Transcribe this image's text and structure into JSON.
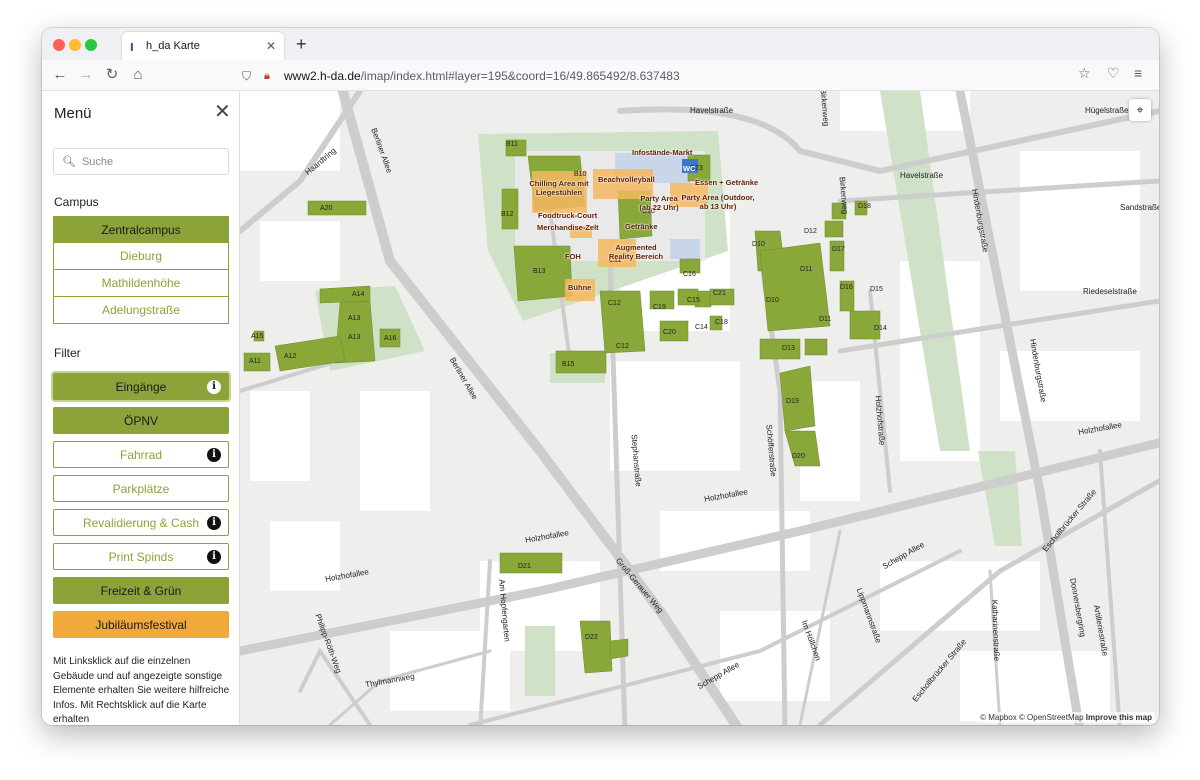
{
  "browser": {
    "tab_title": "h_da Karte",
    "new_tab": "+",
    "url_host": "www2.h-da.de",
    "url_path": "/imap/index.html#layer=195&coord=16/49.865492/8.637483"
  },
  "sidebar": {
    "title": "Menü",
    "search_placeholder": "Suche",
    "campus_label": "Campus",
    "campus": [
      {
        "label": "Zentralcampus",
        "active": true
      },
      {
        "label": "Dieburg",
        "active": false
      },
      {
        "label": "Mathildenhöhe",
        "active": false
      },
      {
        "label": "Adelungstraße",
        "active": false
      }
    ],
    "filter_label": "Filter",
    "filters": [
      {
        "label": "Eingänge",
        "active": true,
        "info": true
      },
      {
        "label": "ÖPNV",
        "active": true,
        "info": false
      },
      {
        "label": "Fahrrad",
        "active": false,
        "info": true
      },
      {
        "label": "Parkplätze",
        "active": false,
        "info": false
      },
      {
        "label": "Revalidierung & Cash",
        "active": false,
        "info": true
      },
      {
        "label": "Print Spinds",
        "active": false,
        "info": true
      },
      {
        "label": "Freizeit & Grün",
        "active": true,
        "info": false
      },
      {
        "label": "Jubiläumsfestival",
        "active": true,
        "info": false
      }
    ],
    "help_text": "Mit Linksklick auf die einzelnen Gebäude und auf angezeigte sonstige Elemente erhalten Sie weitere hilfreiche Infos. Mit Rechtsklick auf die Karte erhalten"
  },
  "map": {
    "streets": [
      "Hügelstraße",
      "Havelstraße",
      "Havelstraße",
      "Sandstraße",
      "Haardtring",
      "Berliner Allee",
      "Berliner Allee",
      "Hindenburgstraße",
      "Hindenburgstraße",
      "Riedeselstraße",
      "Holzhofallee",
      "Holzhofallee",
      "Holzhofallee",
      "Holzhofallee",
      "Stephanstraße",
      "Schöfferstraße",
      "Holzhofstraße",
      "Birkenweg",
      "Birkenweg",
      "Groß-Gerauer Weg",
      "Am Hopfengarten",
      "Philipp-Röth-Weg",
      "Thylmannweg",
      "Schepp Allee",
      "Schepp Allee",
      "Lippmannstraße",
      "Im Höllchen",
      "Eschollbrücker Straße",
      "Eschollbrücker Straße",
      "Katharinenstraße",
      "Donnersbergring",
      "Artilleriestraße"
    ],
    "buildings": [
      "B11",
      "B10",
      "B12",
      "B13",
      "B15",
      "A20",
      "A14",
      "A13",
      "A13",
      "A16",
      "A15",
      "A11",
      "A12",
      "C10",
      "C11",
      "C12",
      "C12",
      "C14",
      "C15",
      "C16",
      "C18",
      "C19",
      "C20",
      "C21",
      "C23",
      "D10",
      "D10",
      "D11",
      "D11",
      "D12",
      "D13",
      "D14",
      "D15",
      "D16",
      "D17",
      "D18",
      "D19",
      "D20",
      "D21",
      "D22"
    ],
    "pois": [
      "Infostände-Markt",
      "Beachvolleyball",
      "Chilling Area mit Liegestühlen",
      "Essen + Getränke",
      "Party Area (ab 22 Uhr)",
      "Party Area (Outdoor, ab 13 Uhr)",
      "Foodtruck-Court",
      "Merchandise-Zelt",
      "Getränke",
      "Augmented Reality Bereich",
      "FOH",
      "Bühne"
    ],
    "wc_label": "WC",
    "attribution_mapbox": "© Mapbox",
    "attribution_osm": "© OpenStreetMap",
    "attribution_improve": "Improve this map"
  },
  "colors": {
    "accent_green": "#8ca33a",
    "building_green": "#8aa83a",
    "park_green": "#cfe1c6",
    "festival_orange": "#f0a93a"
  },
  "icons": [
    "search-icon",
    "close-icon",
    "info-icon",
    "locate-icon",
    "shield-icon",
    "lock-icon",
    "back-icon",
    "forward-icon",
    "reload-icon",
    "home-icon",
    "star-icon",
    "pocket-icon",
    "menu-icon"
  ]
}
